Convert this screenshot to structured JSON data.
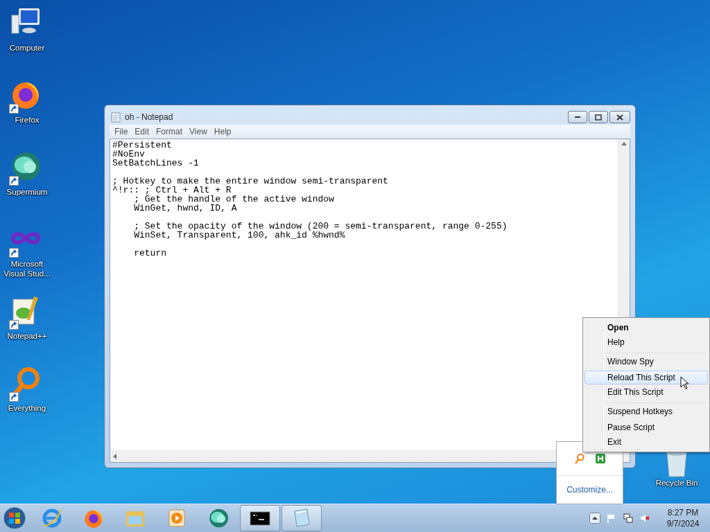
{
  "desktop_icons": [
    {
      "kind": "computer",
      "label": "Computer",
      "shortcut": false
    },
    {
      "kind": "firefox",
      "label": "Firefox",
      "shortcut": true
    },
    {
      "kind": "supermium",
      "label": "Supermium",
      "shortcut": true
    },
    {
      "kind": "visualstudio",
      "label": "Microsoft Visual Stud...",
      "shortcut": true
    },
    {
      "kind": "notepadpp",
      "label": "Notepad++",
      "shortcut": true
    },
    {
      "kind": "everything",
      "label": "Everything",
      "shortcut": true
    }
  ],
  "recycle_bin": {
    "label": "Recycle Bin"
  },
  "notepad": {
    "title": "oh - Notepad",
    "menu": [
      "File",
      "Edit",
      "Format",
      "View",
      "Help"
    ],
    "text": "#Persistent\n#NoEnv\nSetBatchLines -1\n\n; Hotkey to make the entire window semi-transparent\n^!r:: ; Ctrl + Alt + R\n    ; Get the handle of the active window\n    WinGet, hwnd, ID, A\n\n    ; Set the opacity of the window (200 = semi-transparent, range 0-255)\n    WinSet, Transparent, 100, ahk_id %hwnd%\n\n    return"
  },
  "context_menu": [
    {
      "label": "Open",
      "default": true,
      "selected": false,
      "separator_before": false
    },
    {
      "label": "Help",
      "default": false,
      "selected": false,
      "separator_before": false
    },
    {
      "label": "Window Spy",
      "default": false,
      "selected": false,
      "separator_before": true
    },
    {
      "label": "Reload This Script",
      "default": false,
      "selected": true,
      "separator_before": false
    },
    {
      "label": "Edit This Script",
      "default": false,
      "selected": false,
      "separator_before": false
    },
    {
      "label": "Suspend Hotkeys",
      "default": false,
      "selected": false,
      "separator_before": true
    },
    {
      "label": "Pause Script",
      "default": false,
      "selected": false,
      "separator_before": false
    },
    {
      "label": "Exit",
      "default": false,
      "selected": false,
      "separator_before": false
    }
  ],
  "tray_overflow": {
    "icons": [
      {
        "kind": "everything"
      },
      {
        "kind": "ahk"
      }
    ],
    "link": "Customize..."
  },
  "taskbar": {
    "apps": [
      {
        "kind": "ie",
        "running": false
      },
      {
        "kind": "firefox",
        "running": false
      },
      {
        "kind": "explorer",
        "running": false
      },
      {
        "kind": "mediaplayer",
        "running": false
      },
      {
        "kind": "supermium",
        "running": false
      },
      {
        "kind": "cmd",
        "running": true
      },
      {
        "kind": "notepad",
        "running": true
      }
    ],
    "tray_icons": [
      {
        "kind": "chevron"
      },
      {
        "kind": "flag"
      },
      {
        "kind": "network"
      },
      {
        "kind": "volume_muted"
      }
    ],
    "time": "8:27 PM",
    "date": "9/7/2024"
  }
}
